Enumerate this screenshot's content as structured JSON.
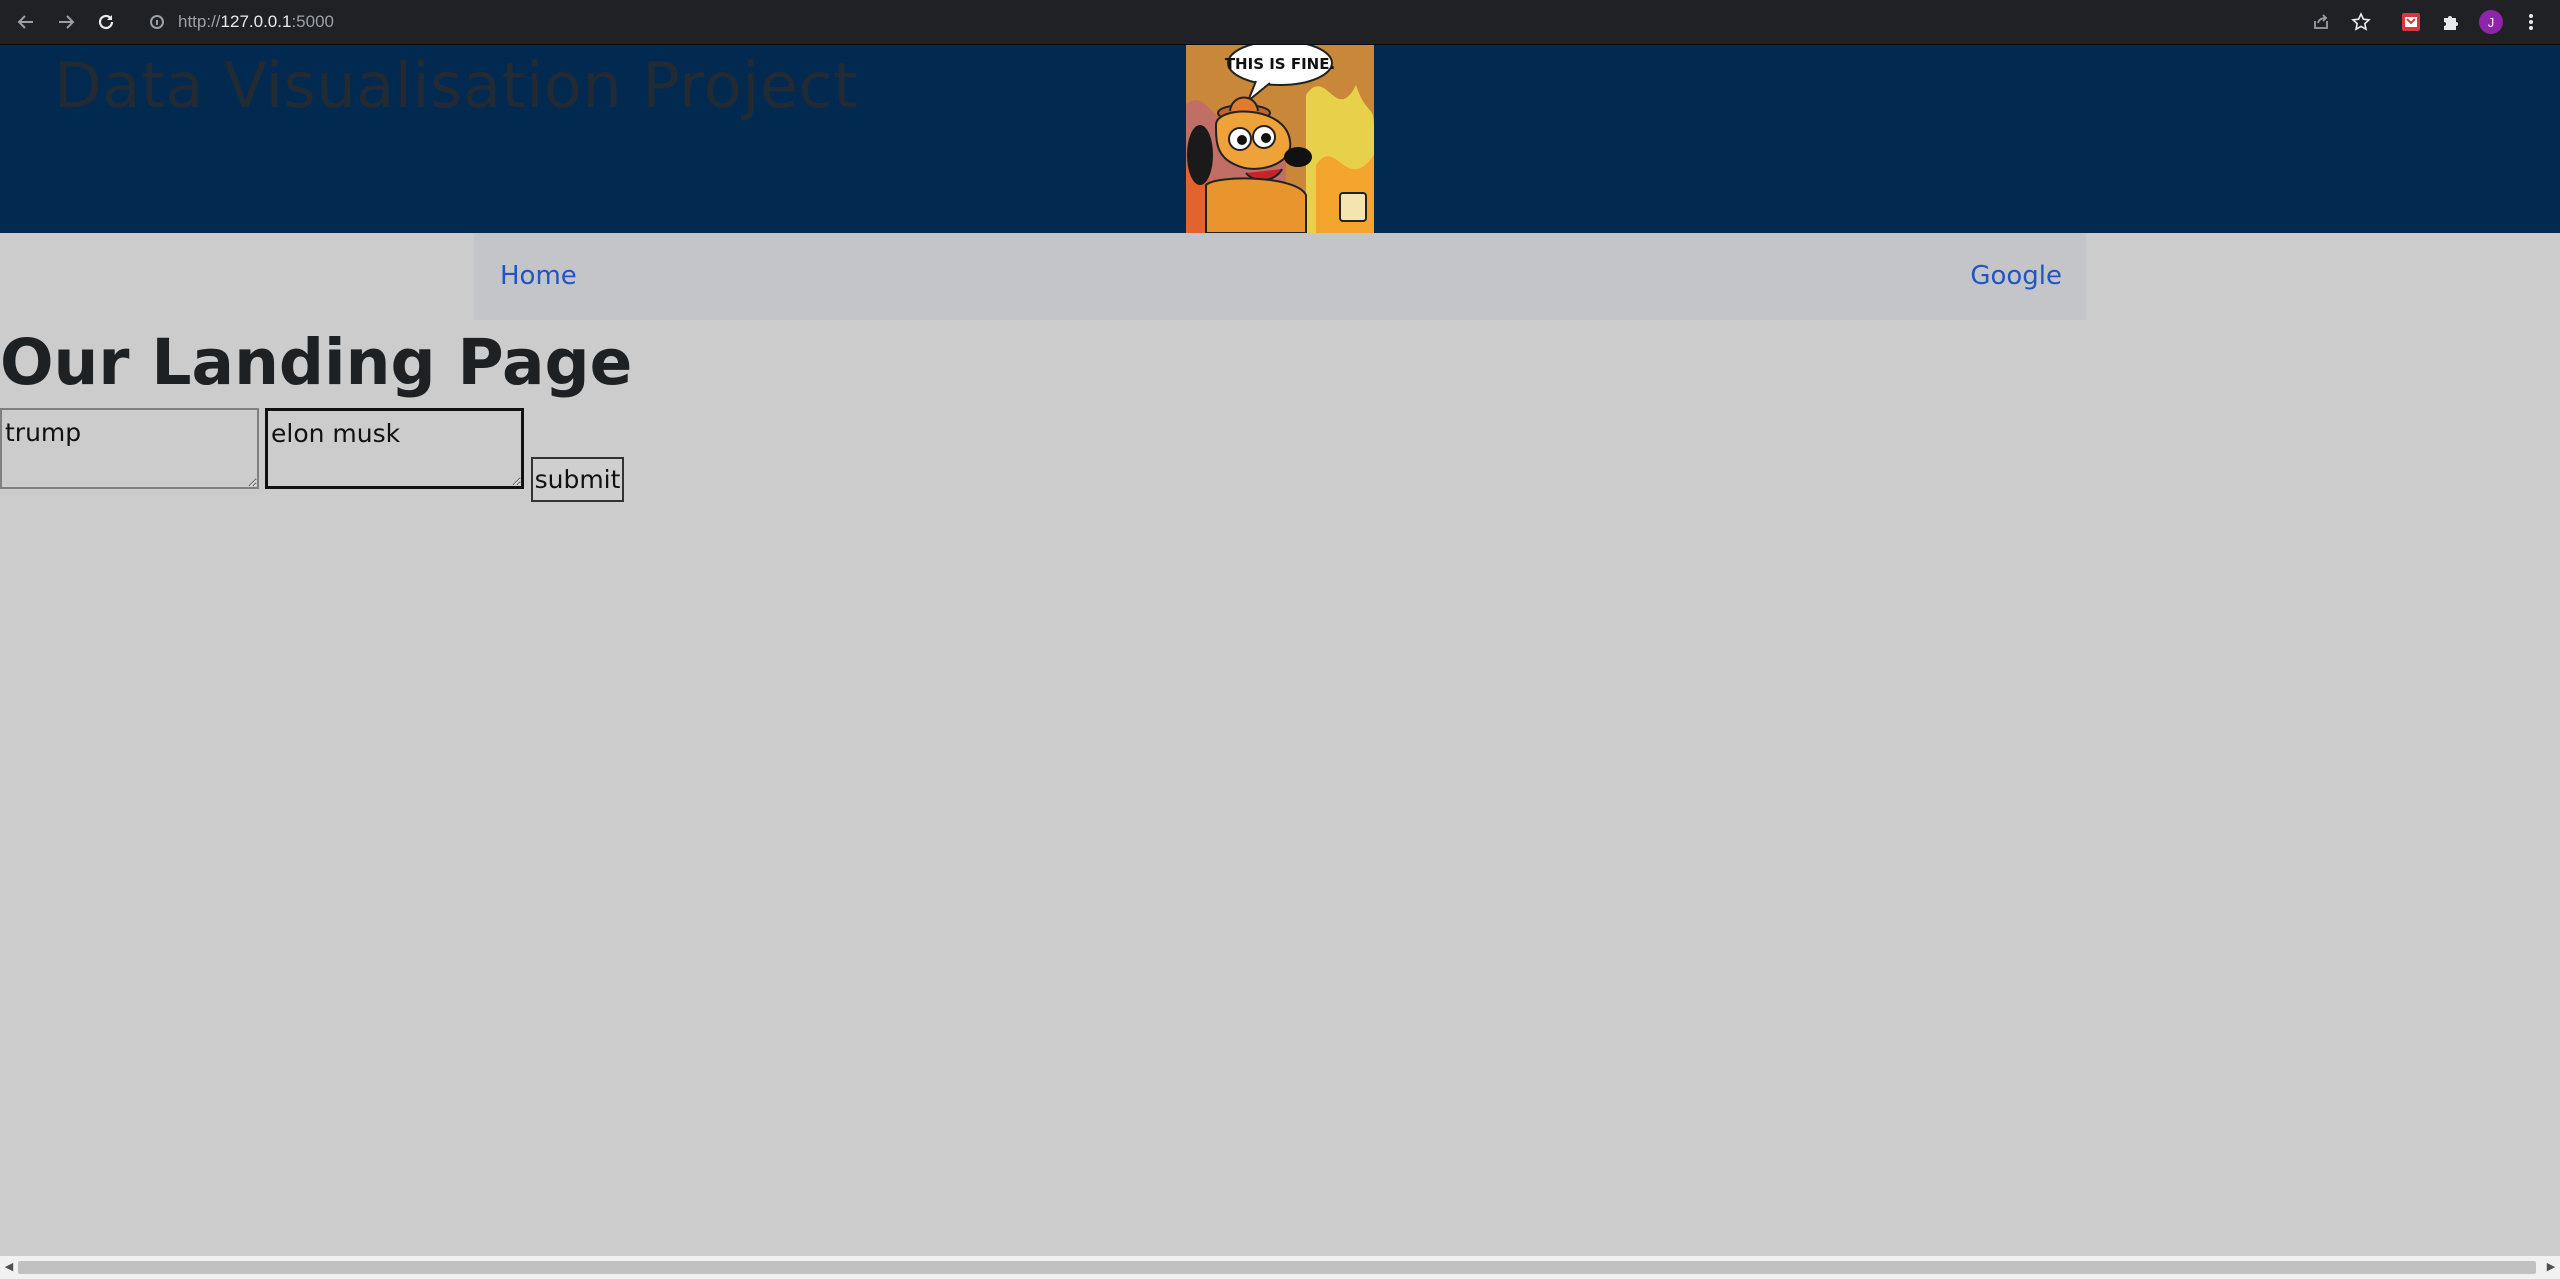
{
  "browser": {
    "url_prefix": "http://",
    "url_host": "127.0.0.1",
    "url_suffix": ":5000",
    "profile_initial": "J",
    "icons": [
      "back-icon",
      "forward-icon",
      "reload-icon",
      "info-icon",
      "share-icon",
      "star-icon",
      "extension-icon",
      "puzzle-icon",
      "profile-avatar",
      "kebab-menu-icon"
    ]
  },
  "header": {
    "title": "Data Visualisation Project",
    "meme_caption": "THIS IS FINE."
  },
  "nav": {
    "home": "Home",
    "google": "Google"
  },
  "main": {
    "heading": "Our Landing Page",
    "input1_value": "trump",
    "input2_value": "elon musk",
    "submit_label": "submit"
  },
  "colors": {
    "header_bg": "#022a50",
    "page_bg": "#cccccc",
    "nav_bg": "#c4c5c8",
    "link": "#2255c4",
    "profile": "#8e24aa"
  }
}
